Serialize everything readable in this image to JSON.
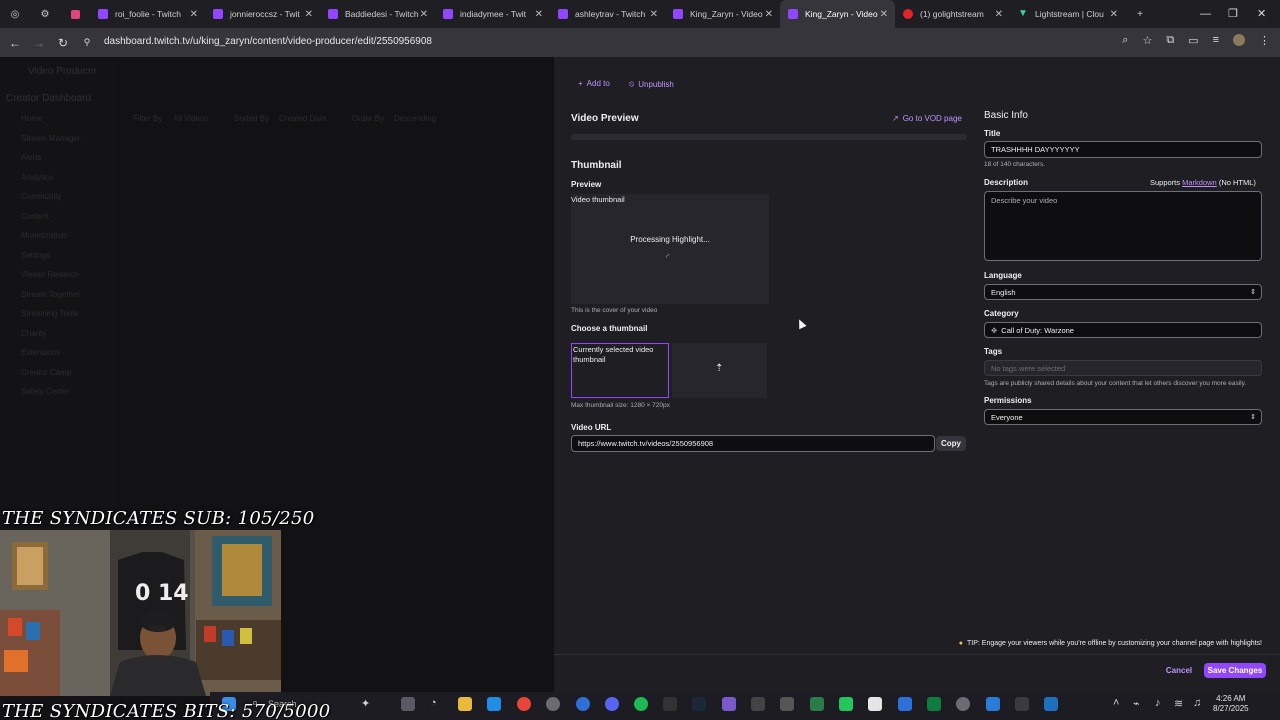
{
  "browser": {
    "tabs": [
      {
        "label": "roi_foolie - Twitch",
        "favicon": "twitch-icon",
        "active": false
      },
      {
        "label": "jonnieroccsz - Twit",
        "favicon": "twitch-icon",
        "active": false
      },
      {
        "label": "Baddiedesi - Twitch",
        "favicon": "twitch-icon",
        "active": false
      },
      {
        "label": "indiadymee - Twit",
        "favicon": "twitch-icon",
        "active": false
      },
      {
        "label": "ashleytrav - Twitch",
        "favicon": "twitch-icon",
        "active": false
      },
      {
        "label": "King_Zaryn - Video",
        "favicon": "twitch-icon",
        "active": false
      },
      {
        "label": "King_Zaryn - Video",
        "favicon": "twitch-icon",
        "active": true
      },
      {
        "label": "(1) golightstream",
        "favicon": "youtube-icon",
        "active": false
      },
      {
        "label": "Lightstream | Clou",
        "favicon": "lightstream-icon",
        "active": false
      }
    ],
    "url": "dashboard.twitch.tv/u/king_zaryn/content/video-producer/edit/2550956908"
  },
  "left_dimmed": {
    "page_title": "Video Producer",
    "sidebar_title": "Creator Dashboard",
    "sidebar_items": [
      "Home",
      "Stream Manager",
      "Alerts",
      "Analytics",
      "Community",
      "Content",
      "Monetization",
      "Settings",
      "Viewer Rewards",
      "Stream Together",
      "Streaming Tools",
      "Charity",
      "Extensions",
      "Creator Camp",
      "Safety Center"
    ],
    "filters": {
      "filter_by_label": "Filter By",
      "filter_by_value": "All Videos",
      "sorted_by_label": "Sorted By",
      "sorted_by_value": "Created Date",
      "order_by_label": "Order By",
      "order_by_value": "Descending"
    }
  },
  "toolbar": {
    "add_to": "Add to",
    "unpublish": "Unpublish"
  },
  "video_preview": {
    "heading": "Video Preview",
    "go_to_vod": "Go to VOD page"
  },
  "thumbnail": {
    "heading": "Thumbnail",
    "preview_label": "Preview",
    "alt_text": "Video thumbnail",
    "processing": "Processing Highlight...",
    "cover_note": "This is the cover of your video",
    "choose_label": "Choose a thumbnail",
    "selected_alt": "Currently selected video thumbnail",
    "max_size": "Max thumbnail size: 1280 × 720px"
  },
  "video_url": {
    "label": "Video URL",
    "value": "https://www.twitch.tv/videos/2550956908",
    "copy": "Copy"
  },
  "basic_info": {
    "heading": "Basic Info",
    "title_label": "Title",
    "title_value": "TRASHHHH DAYYYYYYY",
    "title_count": "18 of 140 characters.",
    "description_label": "Description",
    "supports_prefix": "Supports",
    "markdown_link": "Markdown",
    "no_html": "(No HTML)",
    "description_placeholder": "Describe your video",
    "language_label": "Language",
    "language_value": "English",
    "category_label": "Category",
    "category_value": "Call of Duty: Warzone",
    "tags_label": "Tags",
    "tags_placeholder": "No tags were selected",
    "tags_help": "Tags are publicly shared details about your content that let others discover you more easily.",
    "permissions_label": "Permissions",
    "permissions_value": "Everyone"
  },
  "footer": {
    "tip": "TIP: Engage your viewers while you're offline by customizing your channel page with highlights!",
    "cancel": "Cancel",
    "save": "Save Changes"
  },
  "stream_overlay": {
    "sub_goal": "THE SYNDICATES SUB: 105/250",
    "bits_goal": "THE SYNDICATES BITS: 570/5000"
  },
  "taskbar": {
    "search": "Search",
    "time": "4:26 AM",
    "date": "8/27/2025"
  },
  "colors": {
    "accent": "#9147ff",
    "link": "#bf94ff",
    "panel": "#1f1f23",
    "field": "#0e0e10"
  }
}
